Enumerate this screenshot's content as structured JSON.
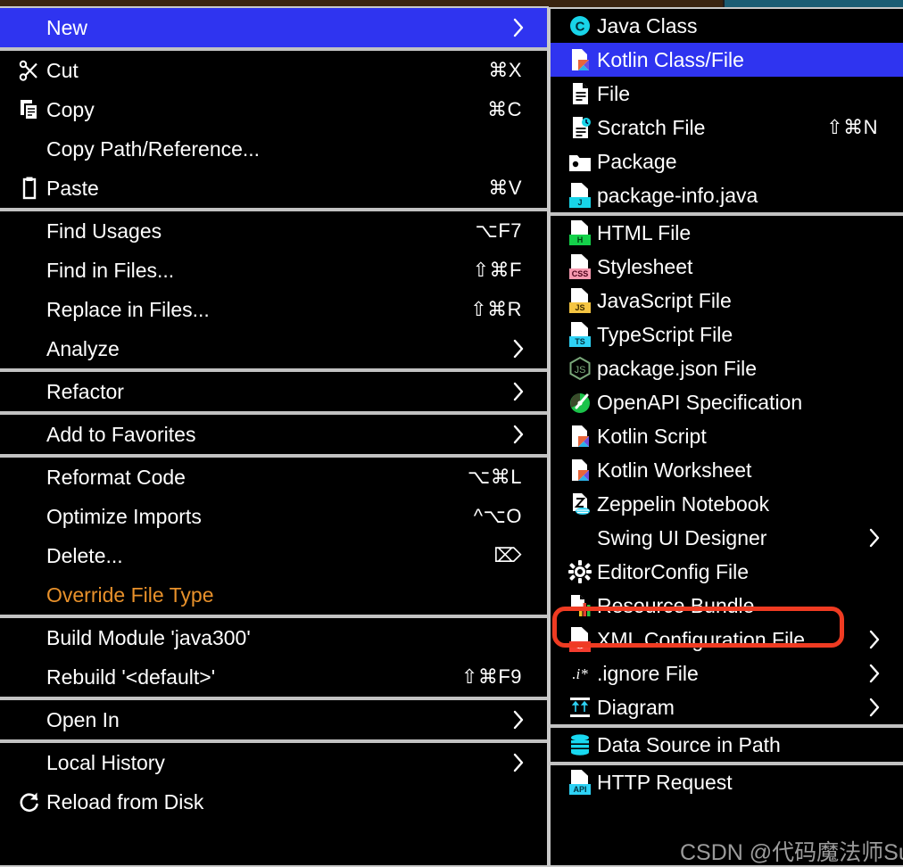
{
  "app": {
    "kind": "ide-context-menu",
    "selected_parent_item": "New",
    "selected_child_item": "Kotlin Class/File",
    "highlight_callout_item": "Resource Bundle"
  },
  "colors": {
    "menu_background": "#000000",
    "menu_text": "#ffffff",
    "selection_blue": "#2f34f0",
    "separator_gray": "#c2c2c2",
    "border_gray": "#c9c9c9",
    "callout_red": "#ef3b22",
    "override_orange": "#e8912b",
    "top_strip_brown": "#3a2410",
    "top_strip_teal": "#1b5d74"
  },
  "watermark": {
    "text": "CSDN @代码魔法师Sunny"
  },
  "context_menu": {
    "groups": [
      {
        "name": "new-group",
        "items": [
          {
            "label": "New",
            "shortcut": "",
            "icon": "",
            "submenu": true,
            "selected": true
          }
        ]
      },
      {
        "name": "clipboard-group",
        "items": [
          {
            "label": "Cut",
            "shortcut": "⌘X",
            "icon": "scissors-icon",
            "submenu": false,
            "selected": false
          },
          {
            "label": "Copy",
            "shortcut": "⌘C",
            "icon": "copy-icon",
            "submenu": false,
            "selected": false
          },
          {
            "label": "Copy Path/Reference...",
            "shortcut": "",
            "icon": "",
            "submenu": false,
            "selected": false
          },
          {
            "label": "Paste",
            "shortcut": "⌘V",
            "icon": "clipboard-icon",
            "submenu": false,
            "selected": false
          }
        ]
      },
      {
        "name": "find-group",
        "items": [
          {
            "label": "Find Usages",
            "shortcut": "⌥F7",
            "icon": "",
            "submenu": false,
            "selected": false
          },
          {
            "label": "Find in Files...",
            "shortcut": "⇧⌘F",
            "icon": "",
            "submenu": false,
            "selected": false
          },
          {
            "label": "Replace in Files...",
            "shortcut": "⇧⌘R",
            "icon": "",
            "submenu": false,
            "selected": false
          },
          {
            "label": "Analyze",
            "shortcut": "",
            "icon": "",
            "submenu": true,
            "selected": false
          }
        ]
      },
      {
        "name": "refactor-group",
        "items": [
          {
            "label": "Refactor",
            "shortcut": "",
            "icon": "",
            "submenu": true,
            "selected": false
          }
        ]
      },
      {
        "name": "favorites-group",
        "items": [
          {
            "label": "Add to Favorites",
            "shortcut": "",
            "icon": "",
            "submenu": true,
            "selected": false
          }
        ]
      },
      {
        "name": "code-group",
        "items": [
          {
            "label": "Reformat Code",
            "shortcut": "⌥⌘L",
            "icon": "",
            "submenu": false,
            "selected": false
          },
          {
            "label": "Optimize Imports",
            "shortcut": "^⌥O",
            "icon": "",
            "submenu": false,
            "selected": false
          },
          {
            "label": "Delete...",
            "shortcut": "⌦",
            "icon": "",
            "submenu": false,
            "selected": false
          },
          {
            "label": "Override File Type",
            "shortcut": "",
            "icon": "",
            "submenu": false,
            "selected": false,
            "color": "orange"
          }
        ]
      },
      {
        "name": "build-group",
        "items": [
          {
            "label": "Build Module 'java300'",
            "shortcut": "",
            "icon": "",
            "submenu": false,
            "selected": false
          },
          {
            "label": "Rebuild '<default>'",
            "shortcut": "⇧⌘F9",
            "icon": "",
            "submenu": false,
            "selected": false
          }
        ]
      },
      {
        "name": "openin-group",
        "items": [
          {
            "label": "Open In",
            "shortcut": "",
            "icon": "",
            "submenu": true,
            "selected": false
          }
        ]
      },
      {
        "name": "history-group",
        "items": [
          {
            "label": "Local History",
            "shortcut": "",
            "icon": "",
            "submenu": true,
            "selected": false
          },
          {
            "label": "Reload from Disk",
            "shortcut": "",
            "icon": "reload-icon",
            "submenu": false,
            "selected": false
          }
        ]
      }
    ]
  },
  "new_submenu": {
    "groups": [
      {
        "name": "java-files-group",
        "items": [
          {
            "label": "Java Class",
            "shortcut": "",
            "icon": "java-class-icon",
            "submenu": false,
            "selected": false
          },
          {
            "label": "Kotlin Class/File",
            "shortcut": "",
            "icon": "kotlin-file-icon",
            "submenu": false,
            "selected": true
          },
          {
            "label": "File",
            "shortcut": "",
            "icon": "file-icon",
            "submenu": false,
            "selected": false
          },
          {
            "label": "Scratch File",
            "shortcut": "⇧⌘N",
            "icon": "scratch-file-icon",
            "submenu": false,
            "selected": false
          },
          {
            "label": "Package",
            "shortcut": "",
            "icon": "package-icon",
            "submenu": false,
            "selected": false
          },
          {
            "label": "package-info.java",
            "shortcut": "",
            "icon": "java-file-icon",
            "submenu": false,
            "selected": false
          }
        ]
      },
      {
        "name": "web-files-group",
        "items": [
          {
            "label": "HTML File",
            "shortcut": "",
            "icon": "html-file-icon",
            "submenu": false,
            "selected": false
          },
          {
            "label": "Stylesheet",
            "shortcut": "",
            "icon": "css-file-icon",
            "submenu": false,
            "selected": false
          },
          {
            "label": "JavaScript File",
            "shortcut": "",
            "icon": "js-file-icon",
            "submenu": false,
            "selected": false
          },
          {
            "label": "TypeScript File",
            "shortcut": "",
            "icon": "ts-file-icon",
            "submenu": false,
            "selected": false
          },
          {
            "label": "package.json File",
            "shortcut": "",
            "icon": "nodejs-icon",
            "submenu": false,
            "selected": false
          },
          {
            "label": "OpenAPI Specification",
            "shortcut": "",
            "icon": "openapi-icon",
            "submenu": false,
            "selected": false
          },
          {
            "label": "Kotlin Script",
            "shortcut": "",
            "icon": "kotlin-script-icon",
            "submenu": false,
            "selected": false
          },
          {
            "label": "Kotlin Worksheet",
            "shortcut": "",
            "icon": "kotlin-worksheet-icon",
            "submenu": false,
            "selected": false
          },
          {
            "label": "Zeppelin Notebook",
            "shortcut": "",
            "icon": "zeppelin-icon",
            "submenu": false,
            "selected": false
          },
          {
            "label": "Swing UI Designer",
            "shortcut": "",
            "icon": "",
            "submenu": true,
            "selected": false
          },
          {
            "label": "EditorConfig File",
            "shortcut": "",
            "icon": "gear-icon",
            "submenu": false,
            "selected": false
          },
          {
            "label": "Resource Bundle",
            "shortcut": "",
            "icon": "resource-bundle-icon",
            "submenu": false,
            "selected": false,
            "callout": true
          },
          {
            "label": "XML Configuration File",
            "shortcut": "",
            "icon": "xml-file-icon",
            "submenu": true,
            "selected": false
          },
          {
            "label": ".ignore File",
            "shortcut": "",
            "icon": "ignore-file-icon",
            "submenu": true,
            "selected": false
          },
          {
            "label": "Diagram",
            "shortcut": "",
            "icon": "diagram-icon",
            "submenu": true,
            "selected": false
          }
        ]
      },
      {
        "name": "data-group",
        "items": [
          {
            "label": "Data Source in Path",
            "shortcut": "",
            "icon": "database-icon",
            "submenu": false,
            "selected": false
          }
        ]
      },
      {
        "name": "http-group",
        "items": [
          {
            "label": "HTTP Request",
            "shortcut": "",
            "icon": "http-request-icon",
            "submenu": false,
            "selected": false
          }
        ]
      }
    ]
  }
}
